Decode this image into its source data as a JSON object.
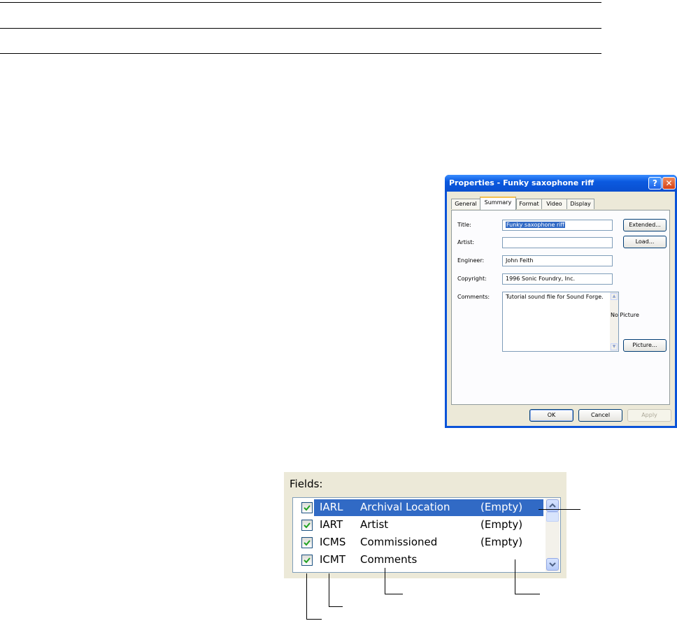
{
  "dialog": {
    "title": "Properties - Funky saxophone riff",
    "help_button": "?",
    "close_button": "✕",
    "tabs": [
      "General",
      "Summary",
      "Format",
      "Video",
      "Display"
    ],
    "active_tab": "Summary",
    "labels": {
      "title": "Title:",
      "artist": "Artist:",
      "engineer": "Engineer:",
      "copyright": "Copyright:",
      "comments": "Comments:"
    },
    "values": {
      "title": "Funky saxophone riff",
      "artist": "",
      "engineer": "John Feith",
      "copyright": "1996 Sonic Foundry, Inc.",
      "comments": "Tutorial sound file for Sound Forge."
    },
    "no_picture": "No Picture",
    "buttons": {
      "extended": "Extended...",
      "load": "Load...",
      "picture": "Picture...",
      "ok": "OK",
      "cancel": "Cancel",
      "apply": "Apply"
    }
  },
  "fields_panel": {
    "label": "Fields:",
    "rows": [
      {
        "code": "IARL",
        "name": "Archival Location",
        "value": "(Empty)",
        "checked": true,
        "selected": true
      },
      {
        "code": "IART",
        "name": "Artist",
        "value": "(Empty)",
        "checked": true,
        "selected": false
      },
      {
        "code": "ICMS",
        "name": "Commissioned",
        "value": "(Empty)",
        "checked": true,
        "selected": false
      },
      {
        "code": "ICMT",
        "name": "Comments",
        "value": "",
        "checked": true,
        "selected": false
      }
    ]
  },
  "colors": {
    "titlebar": "#0a53d8",
    "selection": "#316ac5",
    "dialog_face": "#ece9d8",
    "checkmark": "#21a121"
  },
  "icons": [
    "help-icon",
    "close-icon",
    "checkbox-check-icon",
    "scroll-up-arrow-icon",
    "scroll-down-arrow-icon"
  ]
}
